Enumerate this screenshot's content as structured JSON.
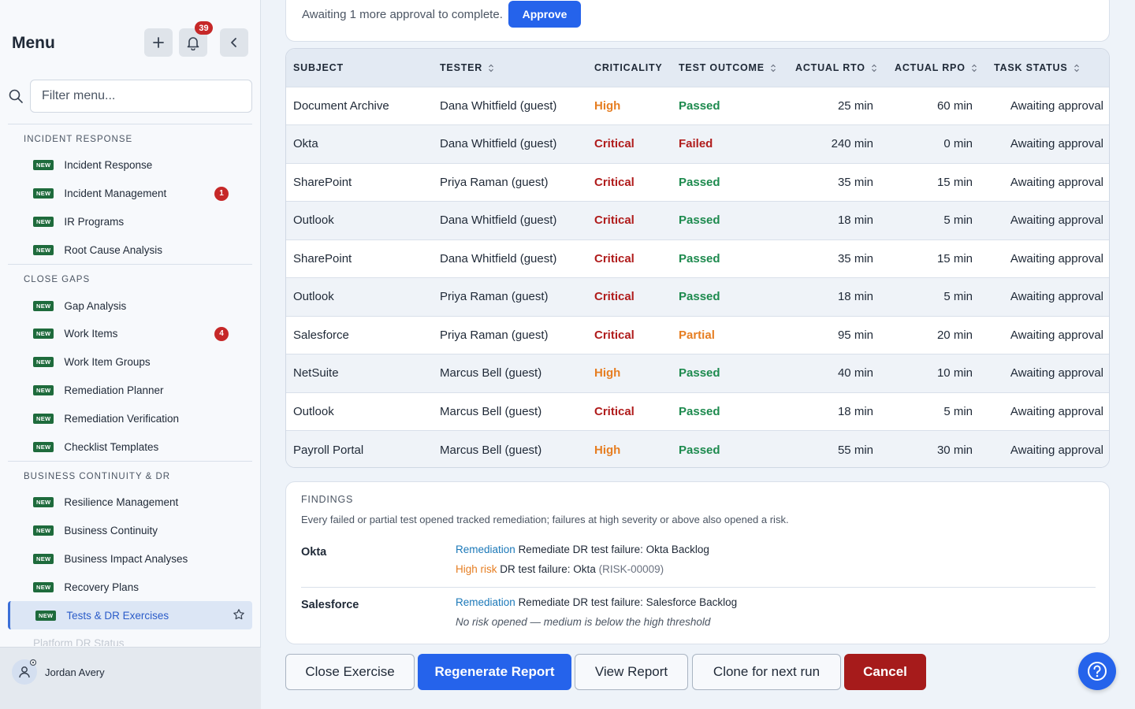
{
  "sidebar": {
    "title": "Menu",
    "notification_count": "39",
    "filter_placeholder": "Filter menu...",
    "new_label": "NEW",
    "sections": [
      {
        "title": "INCIDENT RESPONSE",
        "items": [
          {
            "label": "Incident Response",
            "badge": null
          },
          {
            "label": "Incident Management",
            "badge": "1"
          },
          {
            "label": "IR Programs",
            "badge": null
          },
          {
            "label": "Root Cause Analysis",
            "badge": null
          }
        ]
      },
      {
        "title": "CLOSE GAPS",
        "items": [
          {
            "label": "Gap Analysis",
            "badge": null
          },
          {
            "label": "Work Items",
            "badge": "4"
          },
          {
            "label": "Work Item Groups",
            "badge": null
          },
          {
            "label": "Remediation Planner",
            "badge": null
          },
          {
            "label": "Remediation Verification",
            "badge": null
          },
          {
            "label": "Checklist Templates",
            "badge": null
          }
        ]
      },
      {
        "title": "BUSINESS CONTINUITY & DR",
        "items": [
          {
            "label": "Resilience Management",
            "badge": null
          },
          {
            "label": "Business Continuity",
            "badge": null
          },
          {
            "label": "Business Impact Analyses",
            "badge": null
          },
          {
            "label": "Recovery Plans",
            "badge": null
          },
          {
            "label": "Tests & DR Exercises",
            "badge": null,
            "active": true
          },
          {
            "label": "Platform DR Status",
            "badge": null,
            "faded": true,
            "no_new": true
          }
        ]
      }
    ],
    "user_name": "Jordan Avery"
  },
  "approval": {
    "text": "Awaiting 1 more approval to complete.",
    "button_label": "Approve"
  },
  "table": {
    "columns": [
      {
        "label": "SUBJECT",
        "sortable": false
      },
      {
        "label": "TESTER",
        "sortable": true
      },
      {
        "label": "CRITICALITY",
        "sortable": false
      },
      {
        "label": "TEST OUTCOME",
        "sortable": true
      },
      {
        "label": "ACTUAL RTO",
        "sortable": true
      },
      {
        "label": "ACTUAL RPO",
        "sortable": true
      },
      {
        "label": "TASK STATUS",
        "sortable": true
      }
    ],
    "rows": [
      {
        "subject": "Document Archive",
        "tester": "Dana Whitfield (guest)",
        "criticality": "High",
        "outcome": "Passed",
        "rto": "25 min",
        "rpo": "60 min",
        "status": "Awaiting approval"
      },
      {
        "subject": "Okta",
        "tester": "Dana Whitfield (guest)",
        "criticality": "Critical",
        "outcome": "Failed",
        "rto": "240 min",
        "rpo": "0 min",
        "status": "Awaiting approval"
      },
      {
        "subject": "SharePoint",
        "tester": "Priya Raman (guest)",
        "criticality": "Critical",
        "outcome": "Passed",
        "rto": "35 min",
        "rpo": "15 min",
        "status": "Awaiting approval"
      },
      {
        "subject": "Outlook",
        "tester": "Dana Whitfield (guest)",
        "criticality": "Critical",
        "outcome": "Passed",
        "rto": "18 min",
        "rpo": "5 min",
        "status": "Awaiting approval"
      },
      {
        "subject": "SharePoint",
        "tester": "Dana Whitfield (guest)",
        "criticality": "Critical",
        "outcome": "Passed",
        "rto": "35 min",
        "rpo": "15 min",
        "status": "Awaiting approval"
      },
      {
        "subject": "Outlook",
        "tester": "Priya Raman (guest)",
        "criticality": "Critical",
        "outcome": "Passed",
        "rto": "18 min",
        "rpo": "5 min",
        "status": "Awaiting approval"
      },
      {
        "subject": "Salesforce",
        "tester": "Priya Raman (guest)",
        "criticality": "Critical",
        "outcome": "Partial",
        "rto": "95 min",
        "rpo": "20 min",
        "status": "Awaiting approval"
      },
      {
        "subject": "NetSuite",
        "tester": "Marcus Bell (guest)",
        "criticality": "High",
        "outcome": "Passed",
        "rto": "40 min",
        "rpo": "10 min",
        "status": "Awaiting approval"
      },
      {
        "subject": "Outlook",
        "tester": "Marcus Bell (guest)",
        "criticality": "Critical",
        "outcome": "Passed",
        "rto": "18 min",
        "rpo": "5 min",
        "status": "Awaiting approval"
      },
      {
        "subject": "Payroll Portal",
        "tester": "Marcus Bell (guest)",
        "criticality": "High",
        "outcome": "Passed",
        "rto": "55 min",
        "rpo": "30 min",
        "status": "Awaiting approval"
      }
    ]
  },
  "findings": {
    "title": "FINDINGS",
    "description": "Every failed or partial test opened tracked remediation; failures at high severity or above also opened a risk.",
    "items": [
      {
        "subject": "Okta",
        "remediation_tag": "Remediation",
        "remediation_text": "Remediate DR test failure: Okta Backlog",
        "risk_tag": "High risk",
        "risk_text": "DR test failure: Okta",
        "risk_id": "(RISK-00009)"
      },
      {
        "subject": "Salesforce",
        "remediation_tag": "Remediation",
        "remediation_text": "Remediate DR test failure: Salesforce Backlog",
        "no_risk_text": "No risk opened — medium is below the high threshold"
      }
    ]
  },
  "actions": {
    "close_label": "Close Exercise",
    "regenerate_label": "Regenerate Report",
    "view_label": "View Report",
    "clone_label": "Clone for next run",
    "cancel_label": "Cancel"
  },
  "colors": {
    "primary": "#2563eb",
    "danger": "#a61b1b",
    "high": "#e67e22",
    "critical": "#b01c1c",
    "passed": "#1d8a4e",
    "new_badge": "#1e6b3c"
  }
}
